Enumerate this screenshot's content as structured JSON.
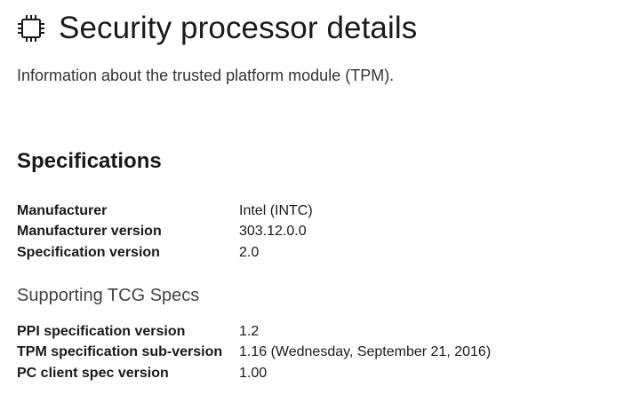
{
  "header": {
    "icon": "chip-icon",
    "title": "Security processor details",
    "subtitle": "Information about the trusted platform module (TPM)."
  },
  "specifications": {
    "heading": "Specifications",
    "rows": [
      {
        "label": "Manufacturer",
        "value": "Intel (INTC)"
      },
      {
        "label": "Manufacturer version",
        "value": "303.12.0.0"
      },
      {
        "label": "Specification version",
        "value": "2.0"
      }
    ]
  },
  "tcg": {
    "heading": "Supporting TCG Specs",
    "rows": [
      {
        "label": "PPI specification version",
        "value": "1.2"
      },
      {
        "label": "TPM specification sub-version",
        "value": "1.16 (Wednesday, September 21, 2016)"
      },
      {
        "label": "PC client spec version",
        "value": "1.00"
      }
    ]
  }
}
